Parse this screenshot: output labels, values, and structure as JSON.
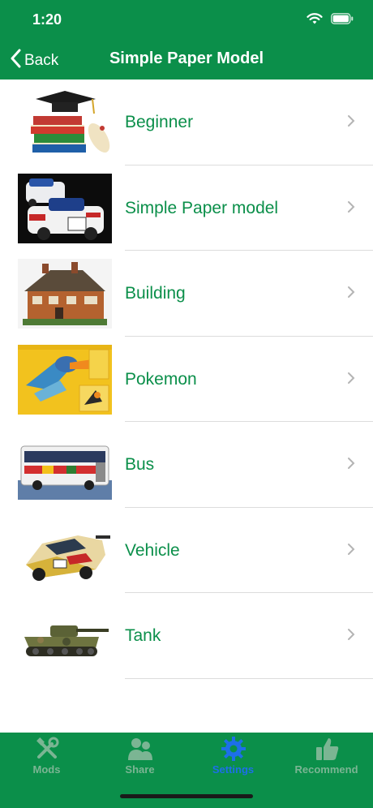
{
  "status": {
    "time": "1:20",
    "icons": [
      "wifi-icon",
      "battery-icon"
    ]
  },
  "nav": {
    "back_label": "Back",
    "title": "Simple Paper Model"
  },
  "list": {
    "items": [
      {
        "label": "Beginner"
      },
      {
        "label": "Simple Paper model"
      },
      {
        "label": "Building"
      },
      {
        "label": "Pokemon"
      },
      {
        "label": "Bus"
      },
      {
        "label": "Vehicle"
      },
      {
        "label": "Tank"
      }
    ]
  },
  "tabs": [
    {
      "label": "Mods",
      "icon": "tools-icon",
      "active": false
    },
    {
      "label": "Share",
      "icon": "users-icon",
      "active": false
    },
    {
      "label": "Settings",
      "icon": "gear-icon",
      "active": true
    },
    {
      "label": "Recommend",
      "icon": "thumbs-up-icon",
      "active": false
    }
  ],
  "colors": {
    "brand": "#0b8f4a",
    "active_tab": "#1d6fe8",
    "inactive_tab": "#7bb593"
  }
}
